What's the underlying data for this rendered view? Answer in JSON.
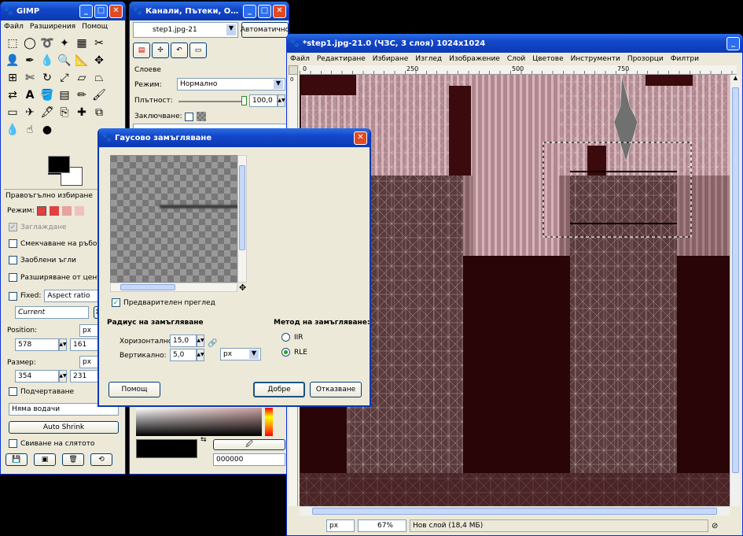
{
  "toolbox": {
    "title": "GIMP",
    "menu": [
      "Файл",
      "Разширения",
      "Помощ"
    ],
    "tool_options_title": "Правоъгълно избиране",
    "mode_label": "Режим:",
    "antialias_label": "Заглаждане",
    "feather_label": "Смекчаване на ръбовете",
    "rounded_label": "Заоблени ъгли",
    "expand_center_label": "Разширяване от центъра",
    "fixed_label": "Fixed:",
    "fixed_value": "Aspect ratio",
    "current_value": "Current",
    "position_label": "Position:",
    "position_unit": "px",
    "position_x": "578",
    "position_y": "161",
    "size_label": "Размер:",
    "size_unit": "px",
    "size_w": "354",
    "size_h": "231",
    "highlight_label": "Подчертаване",
    "guides_value": "Няма водачи",
    "auto_shrink_label": "Auto Shrink",
    "shrink_merged_label": "Свиване на слятото"
  },
  "layers": {
    "title": "Канали, Пътеки, Отменяне",
    "image_select": "step1.jpg-21",
    "auto_button": "Автоматично",
    "section_label": "Слоеве",
    "mode_label": "Режим:",
    "mode_value": "Нормално",
    "opacity_label": "Плътност:",
    "opacity_value": "100,0",
    "lock_label": "Заключване:",
    "hex_value": "000000"
  },
  "image_window": {
    "title": "*step1.jpg-21.0 (ЧЗС, 3 слоя) 1024x1024",
    "menu": [
      "Файл",
      "Редактиране",
      "Избиране",
      "Изглед",
      "Изображение",
      "Слой",
      "Цветове",
      "Инструменти",
      "Прозорци",
      "Филтри"
    ],
    "ruler_ticks": [
      "0",
      "250",
      "500",
      "750"
    ],
    "ruler_v": [
      "0",
      "250",
      "500",
      "750"
    ],
    "unit": "px",
    "zoom": "67%",
    "status": "Нов слой (18,4 MБ)"
  },
  "dialog": {
    "title": "Гаусово замъгляване",
    "preview_label": "Предварителен преглед",
    "radius_title": "Радиус на замъгляване",
    "horizontal_label": "Хоризонтално:",
    "horizontal_value": "15,0",
    "vertical_label": "Вертикално:",
    "vertical_value": "5,0",
    "unit": "px",
    "method_title": "Метод на замъгляване:",
    "method_iir": "IIR",
    "method_rle": "RLE",
    "help_button": "Помощ",
    "ok_button": "Добре",
    "cancel_button": "Отказване"
  },
  "colors": {
    "titlebar": "#1447c8",
    "close": "#e24a23",
    "canvas_bg": "#2a0508",
    "wall": "#c8a0a8"
  }
}
